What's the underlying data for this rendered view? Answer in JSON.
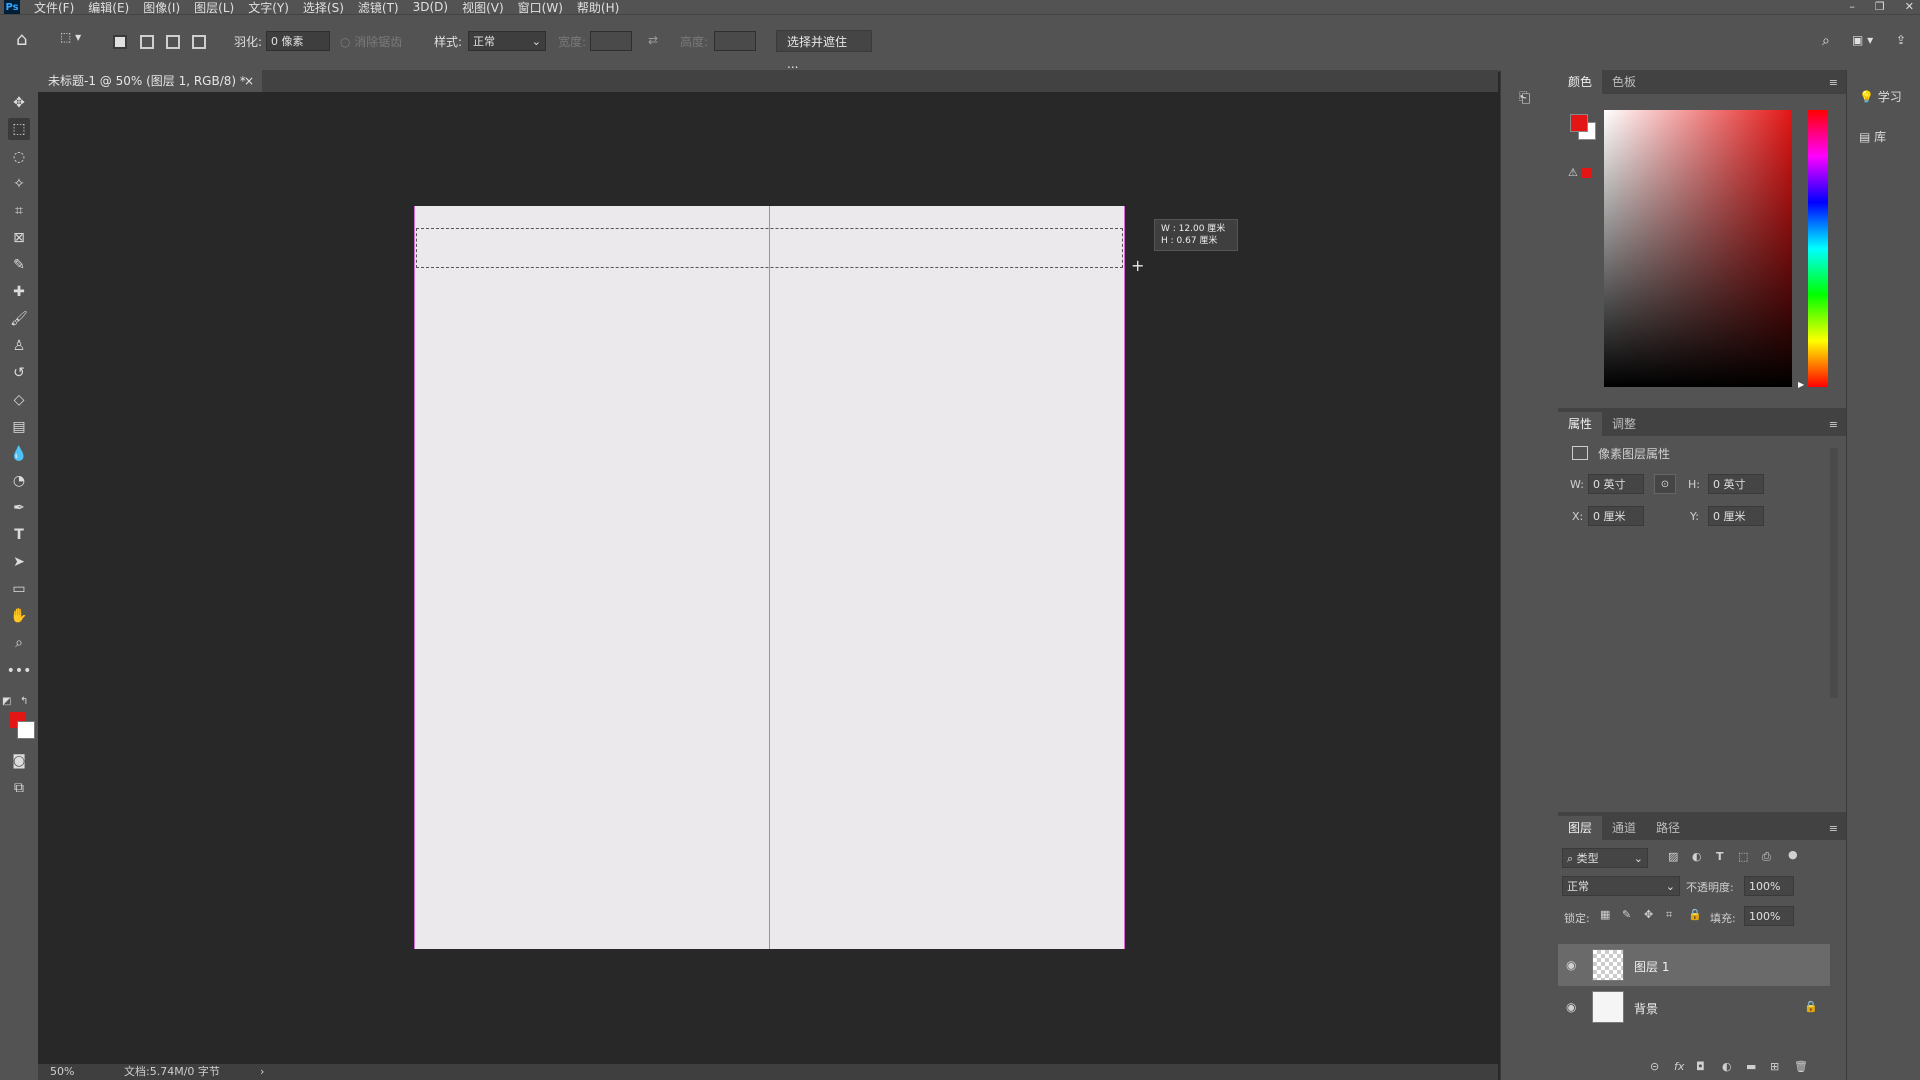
{
  "menubar": {
    "logo": "Ps",
    "items": [
      "文件(F)",
      "编辑(E)",
      "图像(I)",
      "图层(L)",
      "文字(Y)",
      "选择(S)",
      "滤镜(T)",
      "3D(D)",
      "视图(V)",
      "窗口(W)",
      "帮助(H)"
    ]
  },
  "window_controls": {
    "minimize": "–",
    "restore": "❐",
    "close": "✕"
  },
  "options": {
    "feather_label": "羽化:",
    "feather_value": "0 像素",
    "antialias_label": "消除锯齿",
    "style_label": "样式:",
    "style_value": "正常",
    "width_label": "宽度:",
    "height_label": "高度:",
    "select_mask_button": "选择并遮住 ..."
  },
  "document": {
    "tab_title": "未标题-1 @ 50% (图层 1, RGB/8) *",
    "tab_close": "×"
  },
  "tooltip": {
    "w_line": "W :  12.00 厘米",
    "h_line": "H :    0.67 厘米"
  },
  "status": {
    "zoom": "50%",
    "doc_info": "文档:5.74M/0 字节",
    "arrow": "›"
  },
  "color_panel": {
    "tabs": [
      "颜色",
      "色板"
    ],
    "foreground": "#e31515",
    "background": "#ffffff"
  },
  "properties_panel": {
    "tabs": [
      "属性",
      "调整"
    ],
    "title": "像素图层属性",
    "w_label": "W:",
    "w_value": "0 英寸",
    "h_label": "H:",
    "h_value": "0 英寸",
    "x_label": "X:",
    "x_value": "0 厘米",
    "y_label": "Y:",
    "y_value": "0 厘米"
  },
  "layers_panel": {
    "tabs": [
      "图层",
      "通道",
      "路径"
    ],
    "filter_value": "类型",
    "blend_mode": "正常",
    "opacity_label": "不透明度:",
    "opacity_value": "100%",
    "lock_label": "锁定:",
    "fill_label": "填充:",
    "fill_value": "100%",
    "layers": [
      {
        "name": "图层 1",
        "selected": true
      },
      {
        "name": "背景",
        "selected": false
      }
    ]
  },
  "right_dock": {
    "learn": "学习",
    "library": "库"
  }
}
